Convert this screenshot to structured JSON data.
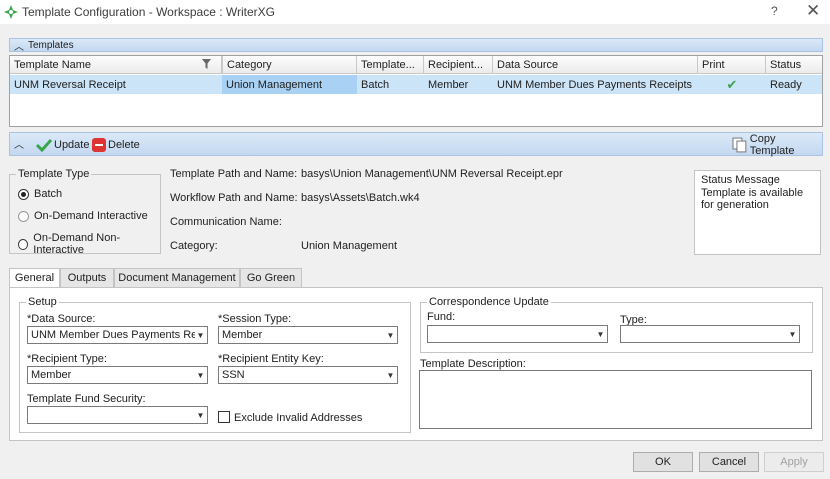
{
  "window": {
    "title": "Template Configuration - Workspace : WriterXG",
    "help": "?",
    "close": "✕"
  },
  "templates_panel": {
    "title": "Templates",
    "columns": [
      "Template Name",
      "Category",
      "Template...",
      "Recipient...",
      "Data Source",
      "Print",
      "Status"
    ],
    "row": {
      "template_name": "UNM Reversal Receipt",
      "category": "Union Management",
      "template_type": "Batch",
      "recipient": "Member",
      "data_source": "UNM Member Dues Payments Receipts",
      "print": "✔",
      "status": "Ready"
    }
  },
  "toolbar": {
    "update": "Update",
    "delete": "Delete",
    "copy_template": "Copy Template"
  },
  "template_type": {
    "legend": "Template Type",
    "options": [
      "Batch",
      "On-Demand Interactive",
      "On-Demand Non-Interactive"
    ],
    "selected": "Batch"
  },
  "info": {
    "template_path_label": "Template Path and Name:",
    "template_path_value": "basys\\Union Management\\UNM Reversal Receipt.epr",
    "workflow_path_label": "Workflow Path and Name:",
    "workflow_path_value": "basys\\Assets\\Batch.wk4",
    "communication_label": "Communication Name:",
    "category_label": "Category:",
    "category_value": "Union Management"
  },
  "status_message": {
    "label": "Status Message",
    "value": "Template is available for generation"
  },
  "tabs": [
    "General",
    "Outputs",
    "Document Management",
    "Go Green"
  ],
  "setup": {
    "legend": "Setup",
    "data_source_label": "*Data Source:",
    "data_source_value": "UNM Member Dues Payments Receipts",
    "session_type_label": "*Session Type:",
    "session_type_value": "Member",
    "recipient_type_label": "*Recipient Type:",
    "recipient_type_value": "Member",
    "recipient_entity_label": "*Recipient Entity Key:",
    "recipient_entity_value": "SSN",
    "fund_security_label": "Template Fund Security:",
    "fund_security_value": "",
    "exclude_label": "Exclude Invalid Addresses"
  },
  "correspondence": {
    "legend": "Correspondence Update",
    "fund_label": "Fund:",
    "fund_value": "",
    "type_label": "Type:",
    "type_value": ""
  },
  "description": {
    "label": "Template Description:"
  },
  "buttons": {
    "ok": "OK",
    "cancel": "Cancel",
    "apply": "Apply"
  }
}
